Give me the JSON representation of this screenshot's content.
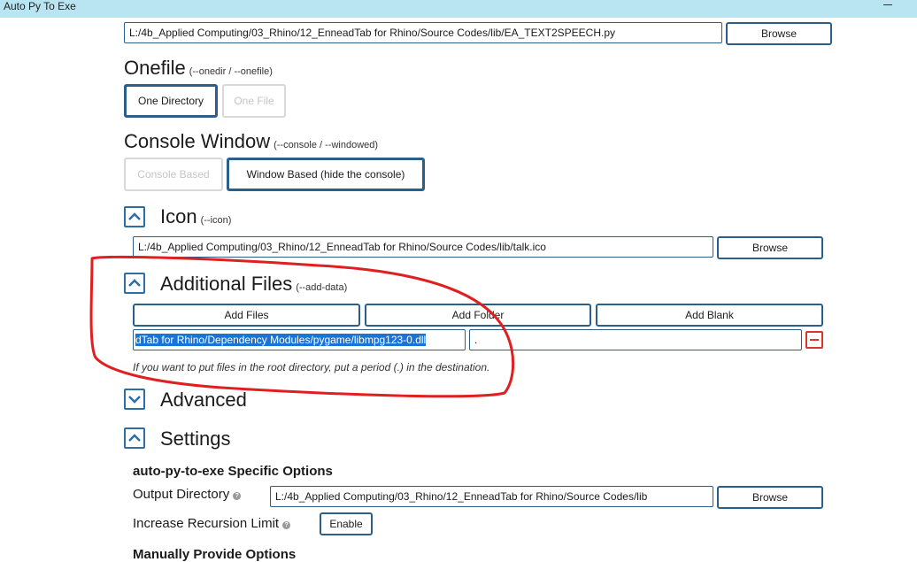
{
  "window": {
    "title": "Auto Py To Exe"
  },
  "script_location": {
    "value": "L:/4b_Applied Computing/03_Rhino/12_EnneadTab for Rhino/Source Codes/lib/EA_TEXT2SPEECH.py",
    "browse_label": "Browse"
  },
  "onefile": {
    "title": "Onefile",
    "hint": "(--onedir / --onefile)",
    "options": [
      "One Directory",
      "One File"
    ],
    "selected": "One Directory"
  },
  "console_window": {
    "title": "Console Window",
    "hint": "(--console / --windowed)",
    "options": [
      "Console Based",
      "Window Based (hide the console)"
    ],
    "selected": "Window Based (hide the console)"
  },
  "icon": {
    "title": "Icon",
    "hint": "(--icon)",
    "value": "L:/4b_Applied Computing/03_Rhino/12_EnneadTab for Rhino/Source Codes/lib/talk.ico",
    "browse_label": "Browse",
    "expanded": true
  },
  "additional_files": {
    "title": "Additional Files",
    "hint": "(--add-data)",
    "buttons": [
      "Add Files",
      "Add Folder",
      "Add Blank"
    ],
    "entries": [
      {
        "source": "dTab for Rhino/Dependency Modules/pygame/libmpg123-0.dll",
        "destination": "."
      }
    ],
    "note": "If you want to put files in the root directory, put a period (.) in the destination.",
    "expanded": true
  },
  "advanced": {
    "title": "Advanced",
    "expanded": false
  },
  "settings": {
    "title": "Settings",
    "expanded": true,
    "specific_options_heading": "auto-py-to-exe Specific Options",
    "output_directory": {
      "label": "Output Directory",
      "value": "L:/4b_Applied Computing/03_Rhino/12_EnneadTab for Rhino/Source Codes/lib",
      "browse_label": "Browse"
    },
    "recursion_limit": {
      "label": "Increase Recursion Limit",
      "button_label": "Enable"
    },
    "manual_options_heading": "Manually Provide Options"
  },
  "colors": {
    "accent": "#2b5f8a",
    "titlebar": "#b9e4f2",
    "annotation": "#e02020",
    "remove": "#d9362a",
    "selection": "#1a73d9"
  }
}
